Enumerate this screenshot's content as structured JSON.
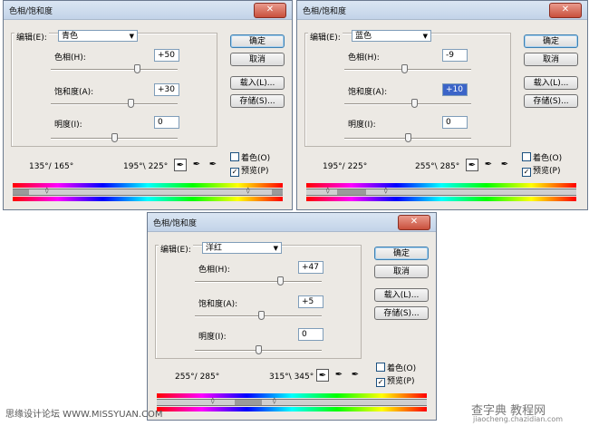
{
  "dialogs": [
    {
      "title": "色相/饱和度",
      "edit_label": "编辑(E):",
      "edit_value": "青色",
      "hue_label": "色相(H):",
      "hue_value": "+50",
      "hue_fraction": 0.68,
      "sat_label": "饱和度(A):",
      "sat_value": "+30",
      "sat_fraction": 0.63,
      "light_label": "明度(I):",
      "light_value": "0",
      "light_fraction": 0.5,
      "range_left": "135°/ 165°",
      "range_right": "195°\\ 225°",
      "buttons": [
        "确定",
        "取消",
        "载入(L)...",
        "存储(S)..."
      ],
      "colorize_label": "着色(O)",
      "colorize_checked": false,
      "preview_label": "预览(P)",
      "preview_checked": true,
      "sat_highlight": false
    },
    {
      "title": "色相/饱和度",
      "edit_label": "编辑(E):",
      "edit_value": "蓝色",
      "hue_label": "色相(H):",
      "hue_value": "-9",
      "hue_fraction": 0.47,
      "sat_label": "饱和度(A):",
      "sat_value": "+10",
      "sat_fraction": 0.55,
      "light_label": "明度(I):",
      "light_value": "0",
      "light_fraction": 0.5,
      "range_left": "195°/ 225°",
      "range_right": "255°\\ 285°",
      "buttons": [
        "确定",
        "取消",
        "载入(L)...",
        "存储(S)..."
      ],
      "colorize_label": "着色(O)",
      "colorize_checked": false,
      "preview_label": "预览(P)",
      "preview_checked": true,
      "sat_highlight": true
    },
    {
      "title": "色相/饱和度",
      "edit_label": "编辑(E):",
      "edit_value": "洋红",
      "hue_label": "色相(H):",
      "hue_value": "+47",
      "hue_fraction": 0.67,
      "sat_label": "饱和度(A):",
      "sat_value": "+5",
      "sat_fraction": 0.52,
      "light_label": "明度(I):",
      "light_value": "0",
      "light_fraction": 0.5,
      "range_left": "255°/ 285°",
      "range_right": "315°\\ 345°",
      "buttons": [
        "确定",
        "取消",
        "载入(L)...",
        "存储(S)..."
      ],
      "colorize_label": "着色(O)",
      "colorize_checked": false,
      "preview_label": "预览(P)",
      "preview_checked": true,
      "sat_highlight": false
    }
  ],
  "watermark_left": "思缘设计论坛 WWW.MISSYUAN.COM",
  "watermark_right": "查字典 教程网",
  "watermark_right_sub": "jiaocheng.chazidian.com",
  "icons": {
    "close": "close-icon",
    "eyedropper": "eyedropper-icon",
    "dropdown": "chevron-down-icon"
  }
}
